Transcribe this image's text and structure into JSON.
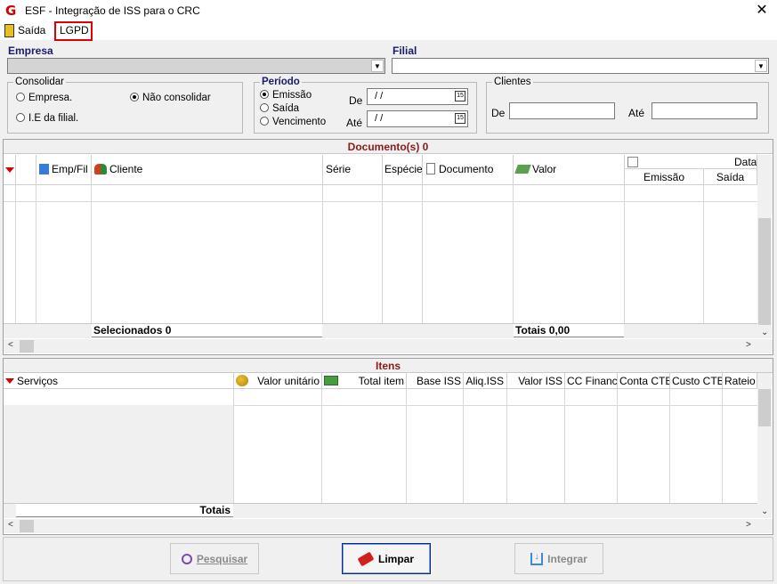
{
  "window": {
    "title": "ESF - Integração de ISS para o CRC",
    "logo": "G"
  },
  "menu": {
    "saida": "Saída",
    "lgpd": "LGPD"
  },
  "filters": {
    "empresa_label": "Empresa",
    "filial_label": "Filial",
    "consolidar": {
      "legend": "Consolidar",
      "options": [
        "Empresa.",
        "Não consolidar",
        "I.E da filial."
      ],
      "selected": "Não consolidar"
    },
    "periodo": {
      "legend": "Período",
      "options": [
        "Emissão",
        "Saída",
        "Vencimento"
      ],
      "selected": "Emissão",
      "de_label": "De",
      "ate_label": "Até",
      "de_value": "/ /",
      "ate_value": "/ /"
    },
    "clientes": {
      "legend": "Clientes",
      "de_label": "De",
      "ate_label": "Até"
    }
  },
  "documentos": {
    "title": "Documento(s) 0",
    "columns": [
      "Emp/Fil",
      "Cliente",
      "Série",
      "Espécie",
      "Documento",
      "Valor",
      "Datas",
      "Emissão",
      "Saída"
    ],
    "selecionados": "Selecionados 0",
    "totais": "Totais 0,00"
  },
  "itens": {
    "title": "Itens",
    "columns": [
      "Serviços",
      "Valor unitário",
      "Total item",
      "Base ISS",
      "Aliq.ISS",
      "Valor ISS",
      "CC Financ",
      "Conta CTB",
      "Custo CTB",
      "Rateio"
    ],
    "totais": "Totais"
  },
  "buttons": {
    "pesquisar": "Pesquisar",
    "limpar": "Limpar",
    "integrar": "Integrar"
  },
  "colors": {
    "accent_red": "#e00000",
    "section_title": "#8b1a1a",
    "label_blue": "#1a1a6e"
  }
}
